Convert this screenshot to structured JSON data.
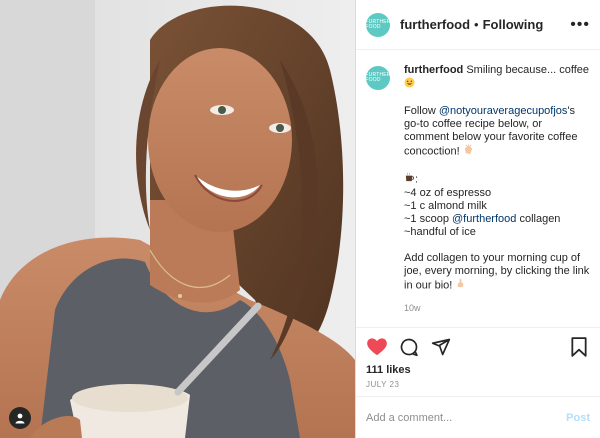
{
  "account": {
    "username": "furtherfood",
    "separator": "•",
    "follow_status": "Following",
    "logo_text": "FURTHER FOOD"
  },
  "caption": {
    "username": "furtherfood",
    "line1": "Smiling because... coffee",
    "p2_prefix": "Follow ",
    "p2_mention": "@notyouraveragecupofjos",
    "p2_suffix": "'s go-to coffee recipe below, or comment below your favorite coffee concoction!",
    "recipe": [
      "~4 oz of espresso",
      "~1 c almond milk"
    ],
    "recipe3_prefix": "~1 scoop ",
    "recipe3_mention": "@furtherfood",
    "recipe3_suffix": " collagen",
    "recipe4": "~handful of ice",
    "p4": "Add collagen to your morning cup of joe, every morning, by clicking the link in our bio!",
    "time_ago": "10w"
  },
  "engagement": {
    "likes": "111 likes",
    "date": "JULY 23"
  },
  "comment": {
    "placeholder": "Add a comment...",
    "post_label": "Post"
  },
  "icons": {
    "more": "more-options-icon",
    "like": "heart-icon",
    "comment": "comment-icon",
    "share": "share-icon",
    "save": "bookmark-icon",
    "tagged": "user-tag-icon"
  },
  "colors": {
    "heart": "#ed4956",
    "logo": "#5ec9c3",
    "mention": "#00376b",
    "post_button": "#b2dffc"
  }
}
